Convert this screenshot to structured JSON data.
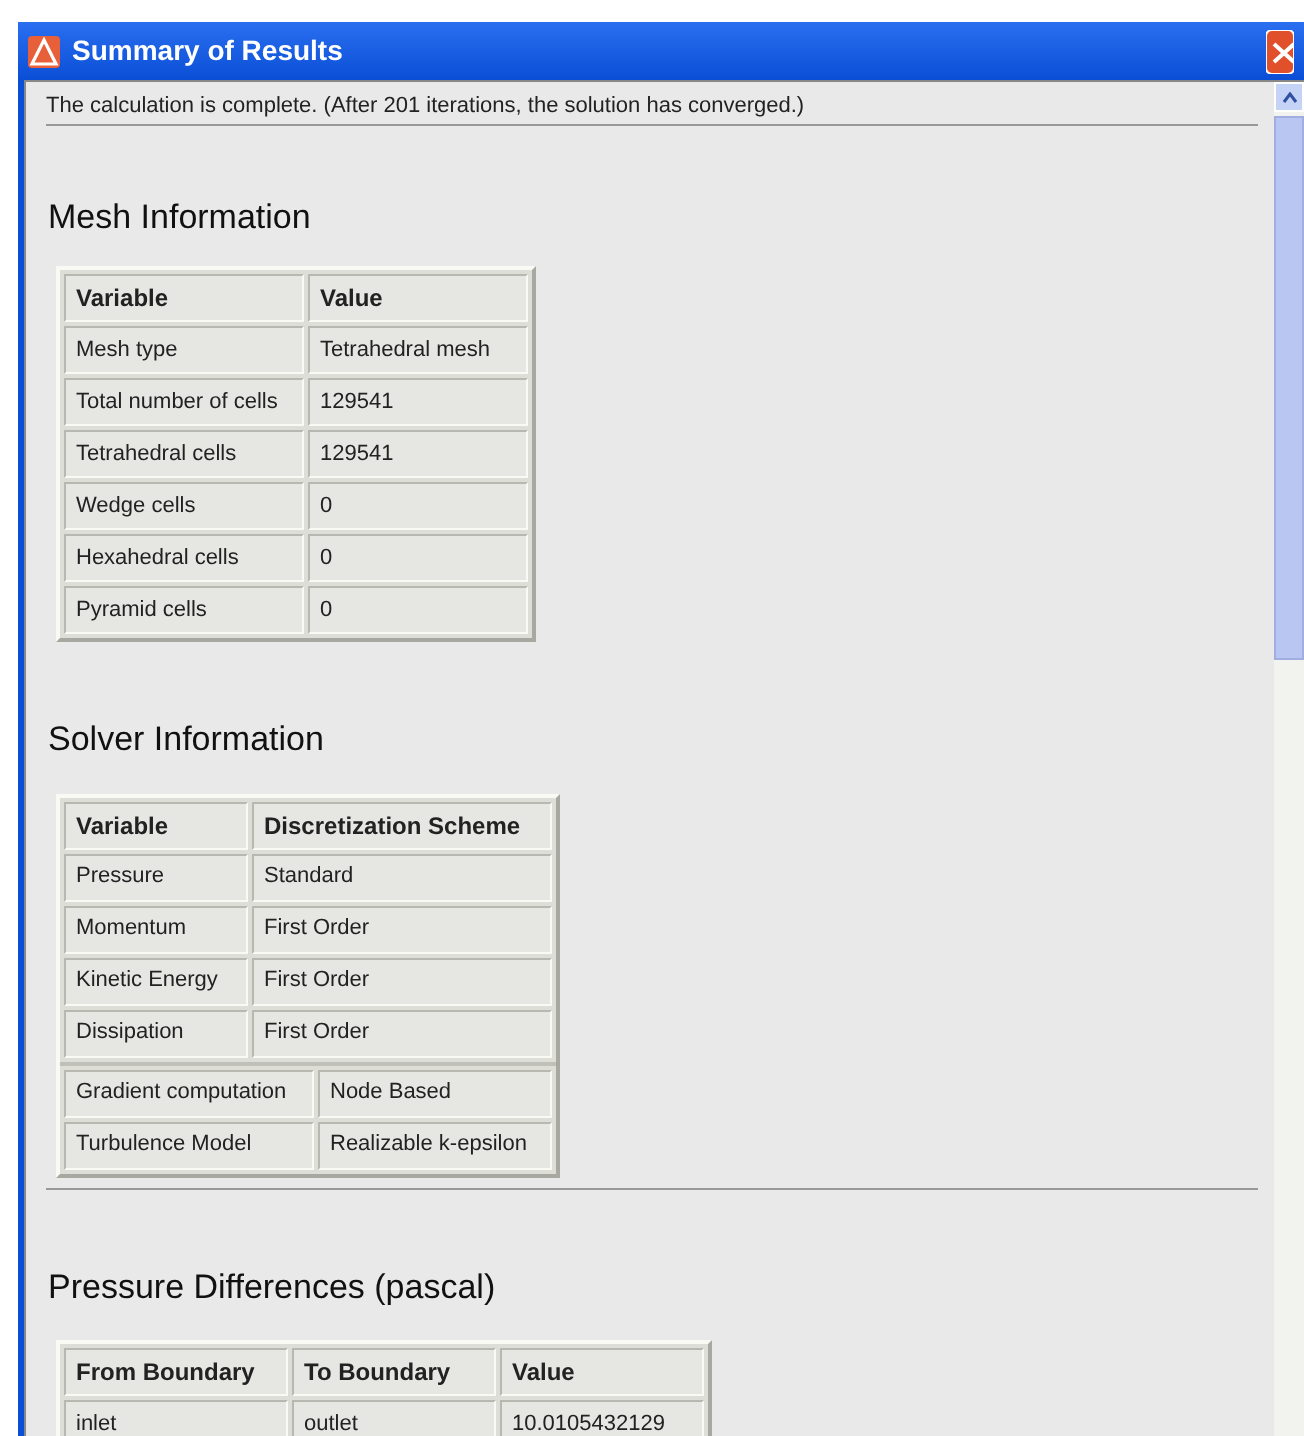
{
  "window": {
    "title": "Summary of Results"
  },
  "message": "The calculation is complete. (After 201 iterations, the solution has converged.)",
  "sections": [
    {
      "heading": "Mesh Information",
      "divider_before": false,
      "tables": [
        {
          "columns": [
            "Variable",
            "Value"
          ],
          "rows": [
            [
              "Mesh type",
              "Tetrahedral mesh"
            ],
            [
              "Total number of cells",
              "129541"
            ],
            [
              "Tetrahedral cells",
              "129541"
            ],
            [
              "Wedge cells",
              "0"
            ],
            [
              "Hexahedral cells",
              "0"
            ],
            [
              "Pyramid cells",
              "0"
            ]
          ]
        }
      ]
    },
    {
      "heading": "Solver Information",
      "divider_before": false,
      "tables": [
        {
          "columns": [
            "Variable",
            "Discretization Scheme"
          ],
          "rows": [
            [
              "Pressure",
              "Standard"
            ],
            [
              "Momentum",
              "First Order"
            ],
            [
              "Kinetic Energy",
              "First Order"
            ],
            [
              "Dissipation",
              "First Order"
            ]
          ]
        },
        {
          "rows": [
            [
              "Gradient computation",
              "Node Based"
            ],
            [
              "Turbulence Model",
              "Realizable k-epsilon"
            ]
          ]
        }
      ]
    },
    {
      "heading": "Pressure Differences (pascal)",
      "divider_before": true,
      "tables": [
        {
          "columns": [
            "From Boundary",
            "To Boundary",
            "Value"
          ],
          "rows": [
            [
              "inlet",
              "outlet",
              "10.0105432129"
            ]
          ]
        }
      ]
    }
  ]
}
